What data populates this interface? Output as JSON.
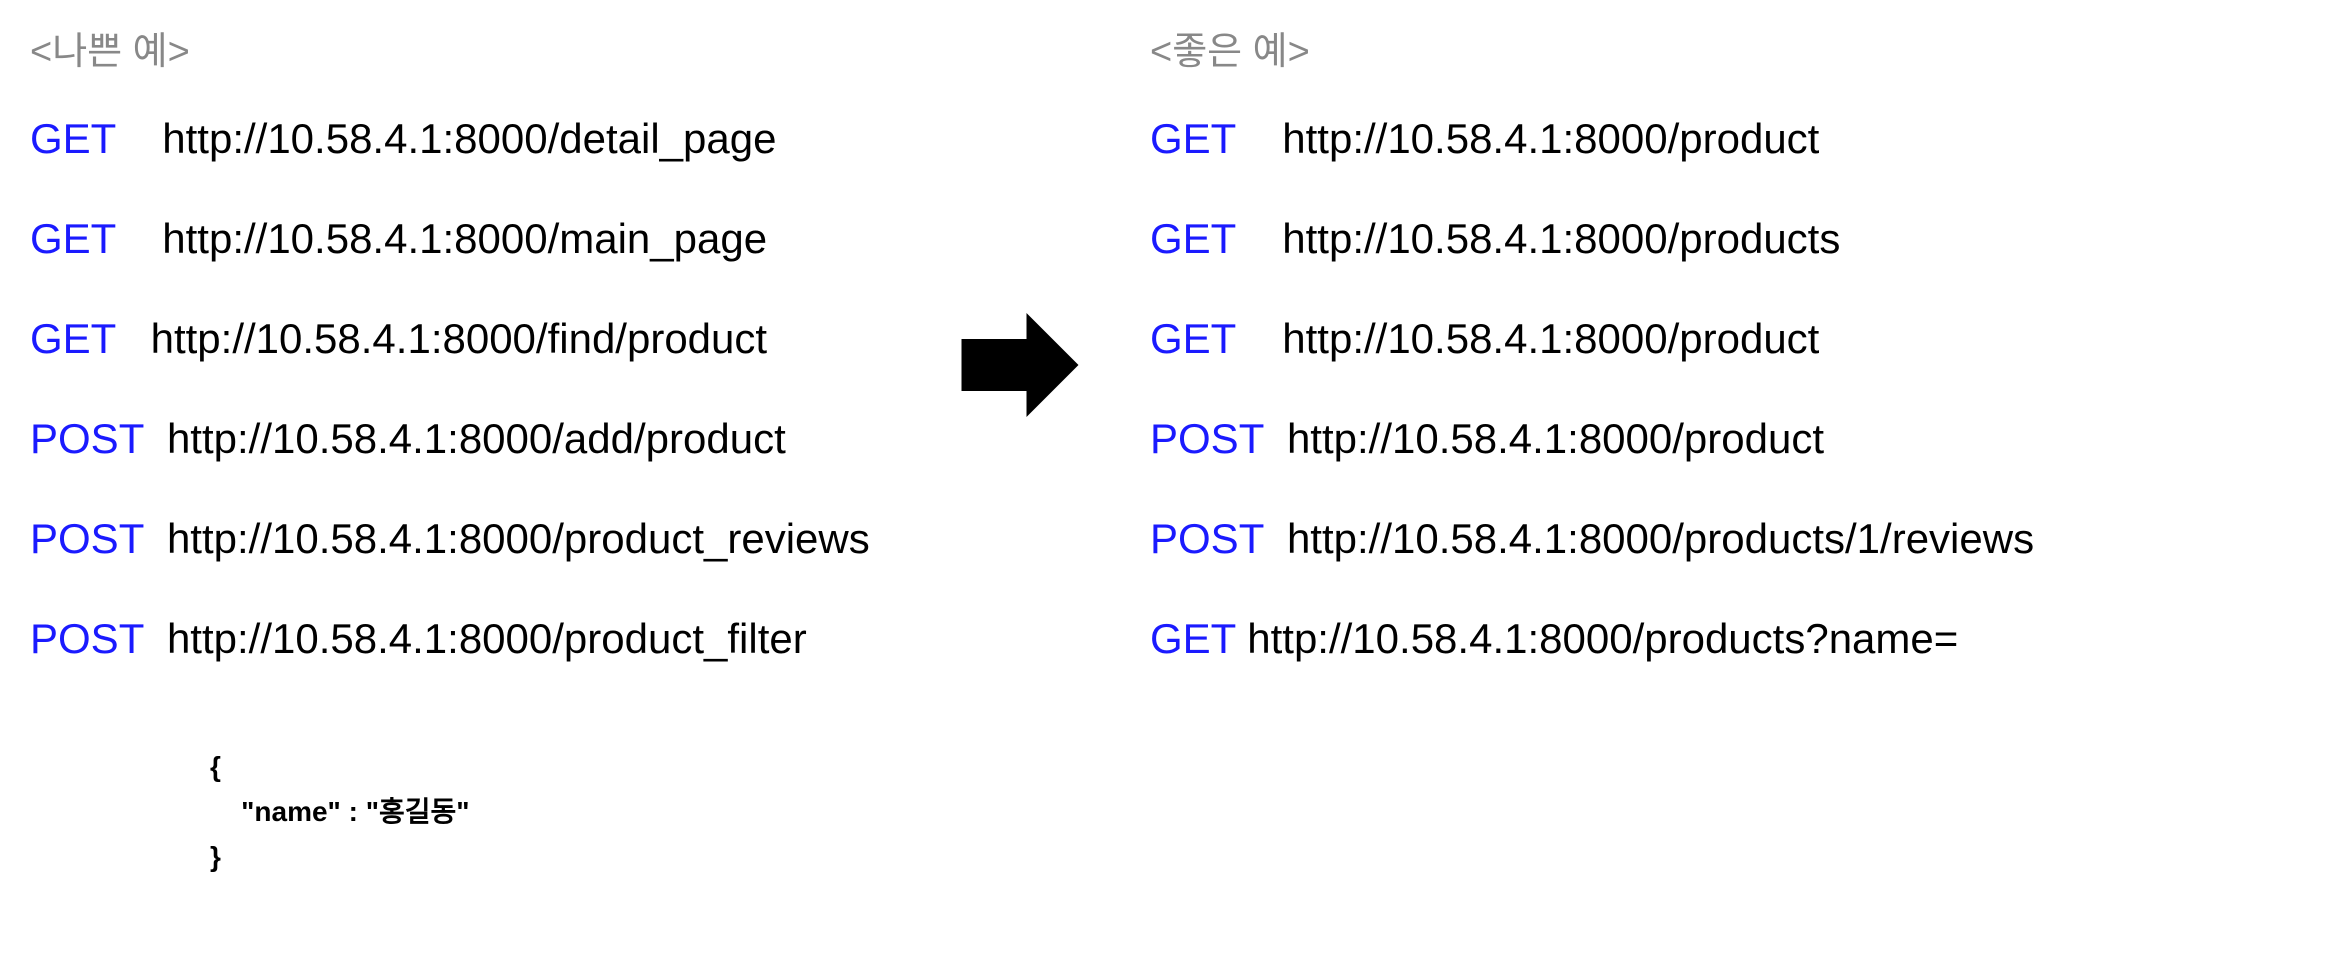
{
  "left": {
    "heading": "<나쁜 예>",
    "entries": [
      {
        "method": "GET    ",
        "url": "http://10.58.4.1:8000/detail_page"
      },
      {
        "method": "GET    ",
        "url": "http://10.58.4.1:8000/main_page"
      },
      {
        "method": "GET   ",
        "url": "http://10.58.4.1:8000/find/product"
      },
      {
        "method": "POST  ",
        "url": "http://10.58.4.1:8000/add/product"
      },
      {
        "method": "POST  ",
        "url": "http://10.58.4.1:8000/product_reviews"
      },
      {
        "method": "POST  ",
        "url": "http://10.58.4.1:8000/product_filter"
      }
    ],
    "json_block": {
      "open": "{",
      "body": "    \"name\" : \"홍길동\"",
      "close": "}"
    }
  },
  "right": {
    "heading": "<좋은 예>",
    "entries": [
      {
        "method": "GET    ",
        "url": "http://10.58.4.1:8000/product"
      },
      {
        "method": "GET    ",
        "url": "http://10.58.4.1:8000/products"
      },
      {
        "method": "GET    ",
        "url": "http://10.58.4.1:8000/product"
      },
      {
        "method": "POST  ",
        "url": "http://10.58.4.1:8000/product"
      },
      {
        "method": "POST  ",
        "url": "http://10.58.4.1:8000/products/1/reviews"
      },
      {
        "method": "GET ",
        "url": "http://10.58.4.1:8000/products?name="
      }
    ]
  }
}
